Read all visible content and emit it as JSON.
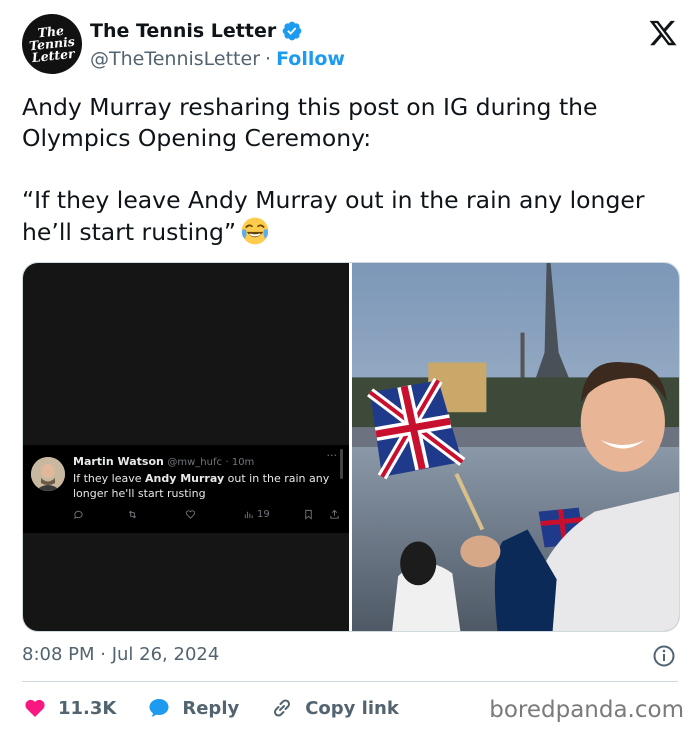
{
  "author": {
    "avatar_lines": [
      "The",
      "Tennis",
      "Letter"
    ],
    "display_name": "The Tennis Letter",
    "handle": "@TheTennisLetter",
    "separator": "·",
    "follow_label": "Follow"
  },
  "tweet": {
    "paragraph1": "Andy Murray resharing this post on IG during the Olympics Opening Ceremony:",
    "paragraph2": "“If they leave Andy Murray out in the rain any longer he’ll start rusting”",
    "emoji": "face-with-tears-of-joy"
  },
  "embedded_tweet": {
    "name": "Martin Watson",
    "handle": "@mw_hufc",
    "time": "· 10m",
    "more": "···",
    "text_before": "If they leave ",
    "text_bold": "Andy Murray",
    "text_after": " out in the rain any longer he'll start rusting",
    "views": "19"
  },
  "meta": {
    "time": "8:08 PM",
    "date": "Jul 26, 2024",
    "separator": " · "
  },
  "actions": {
    "likes": "11.3K",
    "reply_label": "Reply",
    "copy_label": "Copy link"
  },
  "watermark": "boredpanda.com",
  "colors": {
    "accent": "#1d9bf0",
    "like": "#f91880",
    "muted": "#536471"
  }
}
